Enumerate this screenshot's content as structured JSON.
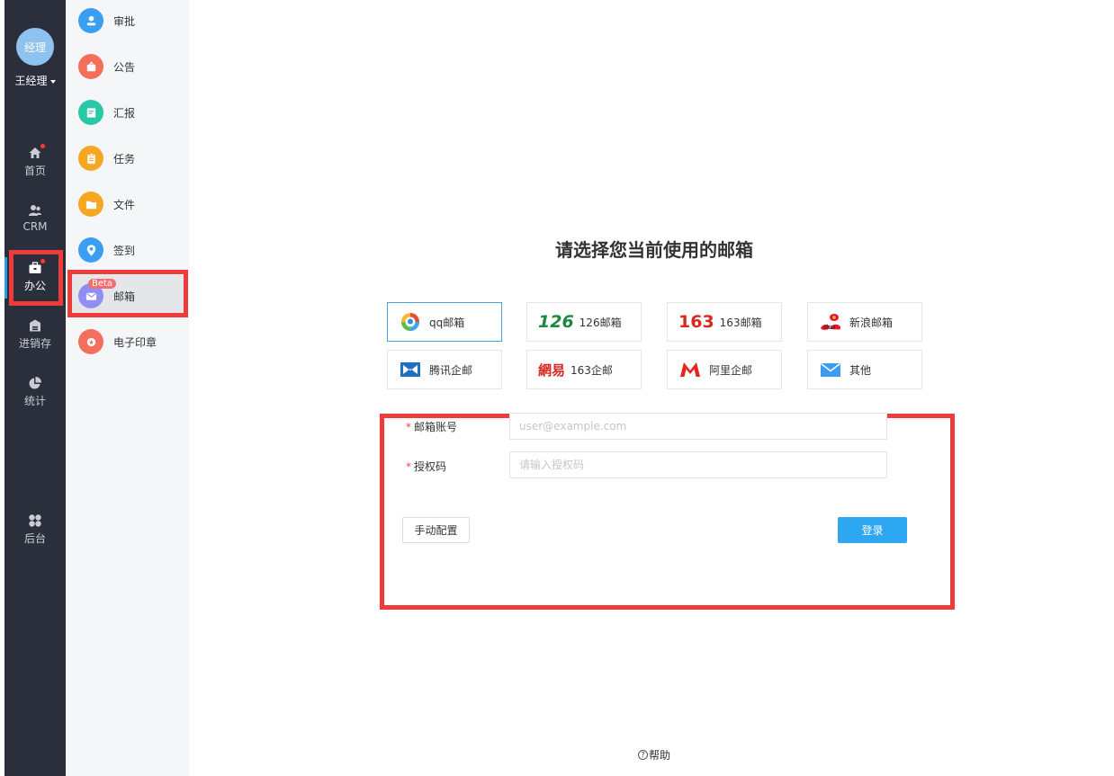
{
  "user": {
    "avatar_text": "经理",
    "name": "王经理"
  },
  "main_nav": [
    {
      "label": "首页",
      "icon": "home-icon",
      "badge": true
    },
    {
      "label": "CRM",
      "icon": "crm-icon",
      "badge": false
    },
    {
      "label": "办公",
      "icon": "office-icon",
      "badge": true,
      "active": true
    },
    {
      "label": "进销存",
      "icon": "inventory-icon",
      "badge": false
    },
    {
      "label": "统计",
      "icon": "pie-chart-icon",
      "badge": false
    },
    {
      "label": "后台",
      "icon": "grid-icon",
      "badge": false
    }
  ],
  "sub_nav": [
    {
      "label": "审批",
      "icon": "approval-icon",
      "color": "#3a9ef2"
    },
    {
      "label": "公告",
      "icon": "announcement-icon",
      "color": "#f36f5c"
    },
    {
      "label": "汇报",
      "icon": "report-icon",
      "color": "#28c7a5"
    },
    {
      "label": "任务",
      "icon": "task-icon",
      "color": "#f5a623"
    },
    {
      "label": "文件",
      "icon": "folder-icon",
      "color": "#f5a623"
    },
    {
      "label": "签到",
      "icon": "location-icon",
      "color": "#3a9ef2"
    },
    {
      "label": "邮箱",
      "icon": "mail-icon",
      "color": "#8e8ff0",
      "badge": "Beta",
      "selected": true
    },
    {
      "label": "电子印章",
      "icon": "seal-icon",
      "color": "#f36f5c"
    }
  ],
  "main": {
    "title": "请选择您当前使用的邮箱",
    "providers": [
      {
        "label": "qq邮箱",
        "icon": "qq-mail-icon",
        "selected": true
      },
      {
        "label": "126邮箱",
        "logo_text": "126",
        "icon": "126-logo-icon",
        "color": "#1a8a3a"
      },
      {
        "label": "163邮箱",
        "logo_text": "163",
        "icon": "163-logo-icon",
        "color": "#d8281f"
      },
      {
        "label": "新浪邮箱",
        "icon": "sina-logo-icon"
      },
      {
        "label": "腾讯企邮",
        "icon": "tencent-exmail-icon"
      },
      {
        "label": "163企邮",
        "logo_text": "網易",
        "icon": "netease-logo-icon",
        "color": "#d8281f"
      },
      {
        "label": "阿里企邮",
        "icon": "ali-mail-icon"
      },
      {
        "label": "其他",
        "icon": "envelope-icon"
      }
    ],
    "form": {
      "account_label": "邮箱账号",
      "account_placeholder": "user@example.com",
      "auth_label": "授权码",
      "auth_placeholder": "请输入授权码",
      "manual_button": "手动配置",
      "login_button": "登录"
    },
    "help_label": "帮助"
  },
  "colors": {
    "highlight": "#ee3b3b",
    "primary": "#2ea7f3",
    "nav_bg": "#2b2f3c"
  }
}
